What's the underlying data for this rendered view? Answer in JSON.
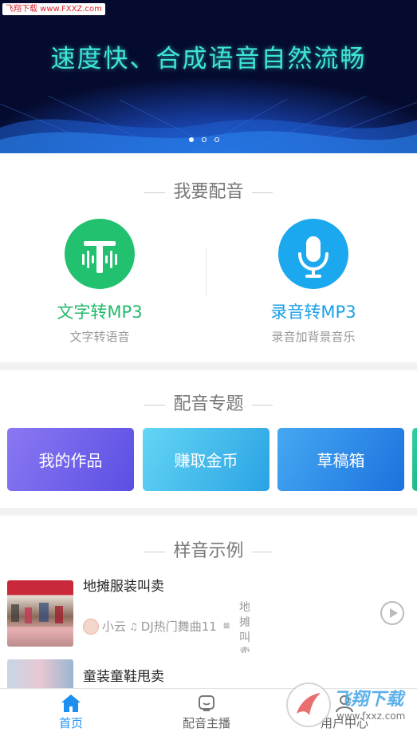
{
  "watermark": "飞翔下载 www.FXXZ.com",
  "banner": {
    "headline": "速度快、合成语音自然流畅",
    "pages": 3,
    "active_page": 1
  },
  "dubbing": {
    "title": "我要配音",
    "options": [
      {
        "label": "文字转MP3",
        "sub": "文字转语音",
        "color": "#22c16f",
        "icon": "text-wave-icon"
      },
      {
        "label": "录音转MP3",
        "sub": "录音加背景音乐",
        "color": "#1ba8ef",
        "icon": "microphone-icon"
      }
    ]
  },
  "topics": {
    "title": "配音专题",
    "cards": [
      {
        "label": "我的作品",
        "color_from": "#7b6cf0",
        "color_to": "#5b4fe3"
      },
      {
        "label": "赚取金币",
        "color_from": "#5ad0f2",
        "color_to": "#2aa8e6"
      },
      {
        "label": "草稿箱",
        "color_from": "#3a9ef0",
        "color_to": "#1c78e0"
      },
      {
        "label": "",
        "color_from": "#2fd0a0",
        "color_to": "#19b486"
      }
    ]
  },
  "samples": {
    "title": "样音示例",
    "items": [
      {
        "title": "地摊服装叫卖",
        "author": "小云",
        "music": "DJ热门舞曲11",
        "extra": "地摊叫卖"
      },
      {
        "title": "童装童鞋甩卖",
        "author": "",
        "music": "",
        "extra": ""
      }
    ]
  },
  "tabbar": {
    "tabs": [
      {
        "label": "首页",
        "icon": "home-icon",
        "active": true
      },
      {
        "label": "配音主播",
        "icon": "anchor-headset-icon",
        "active": false
      },
      {
        "label": "用户中心",
        "icon": "user-icon",
        "active": false
      }
    ],
    "active_color": "#1d8ff0",
    "inactive_color": "#777777"
  },
  "bottom_watermark": {
    "brand": "飞翔下载",
    "url": "www.fxxz.com"
  }
}
